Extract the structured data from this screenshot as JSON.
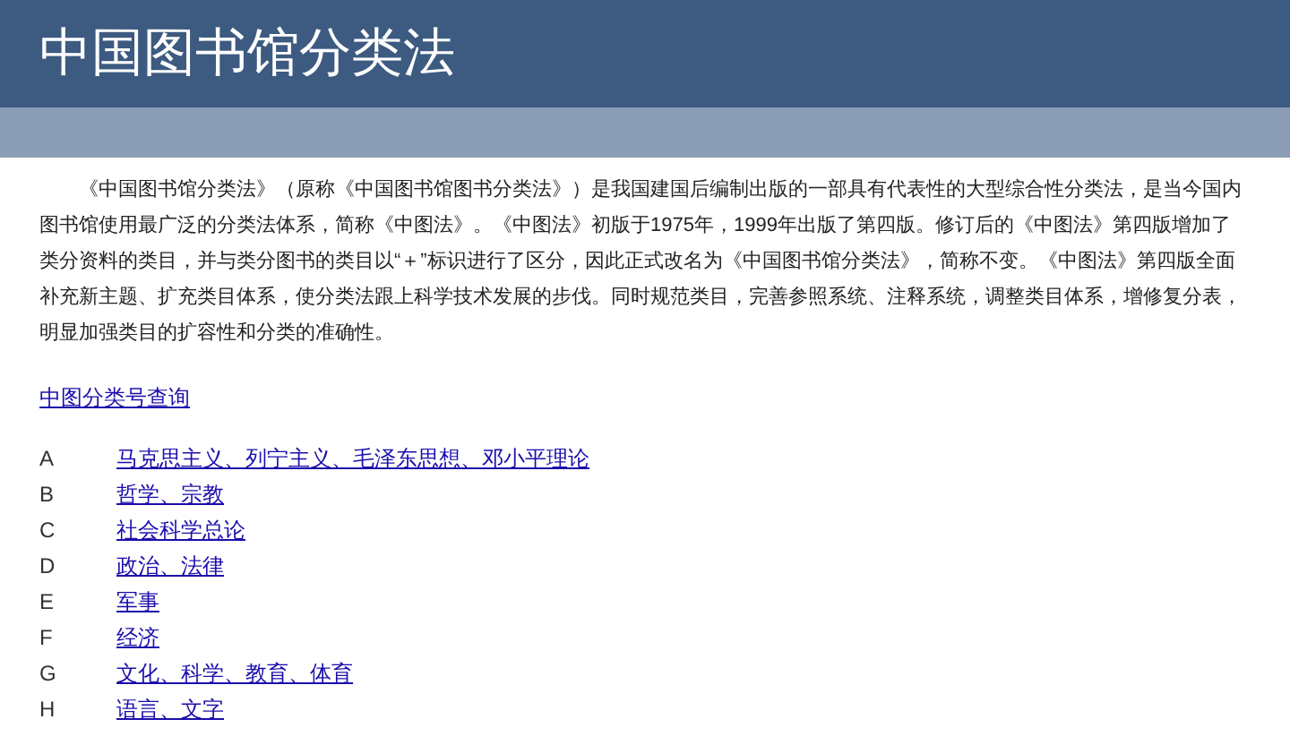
{
  "header": {
    "title": "中国图书馆分类法"
  },
  "intro": "《中国图书馆分类法》（原称《中国图书馆图书分类法》）是我国建国后编制出版的一部具有代表性的大型综合性分类法，是当今国内图书馆使用最广泛的分类法体系，简称《中图法》。《中图法》初版于1975年，1999年出版了第四版。修订后的《中图法》第四版增加了类分资料的类目，并与类分图书的类目以“＋”标识进行了区分，因此正式改名为《中国图书馆分类法》，简称不变。《中图法》第四版全面补充新主题、扩充类目体系，使分类法跟上科学技术发展的步伐。同时规范类目，完善参照系统、注释系统，调整类目体系，增修复分表，明显加强类目的扩容性和分类的准确性。",
  "lookup_link": "中图分类号查询",
  "categories": [
    {
      "code": "A",
      "name": "马克思主义、列宁主义、毛泽东思想、邓小平理论"
    },
    {
      "code": "B",
      "name": "哲学、宗教"
    },
    {
      "code": "C",
      "name": "社会科学总论"
    },
    {
      "code": "D",
      "name": "政治、法律"
    },
    {
      "code": "E",
      "name": "军事"
    },
    {
      "code": "F",
      "name": "经济"
    },
    {
      "code": "G",
      "name": "文化、科学、教育、体育"
    },
    {
      "code": "H",
      "name": "语言、文字"
    }
  ]
}
